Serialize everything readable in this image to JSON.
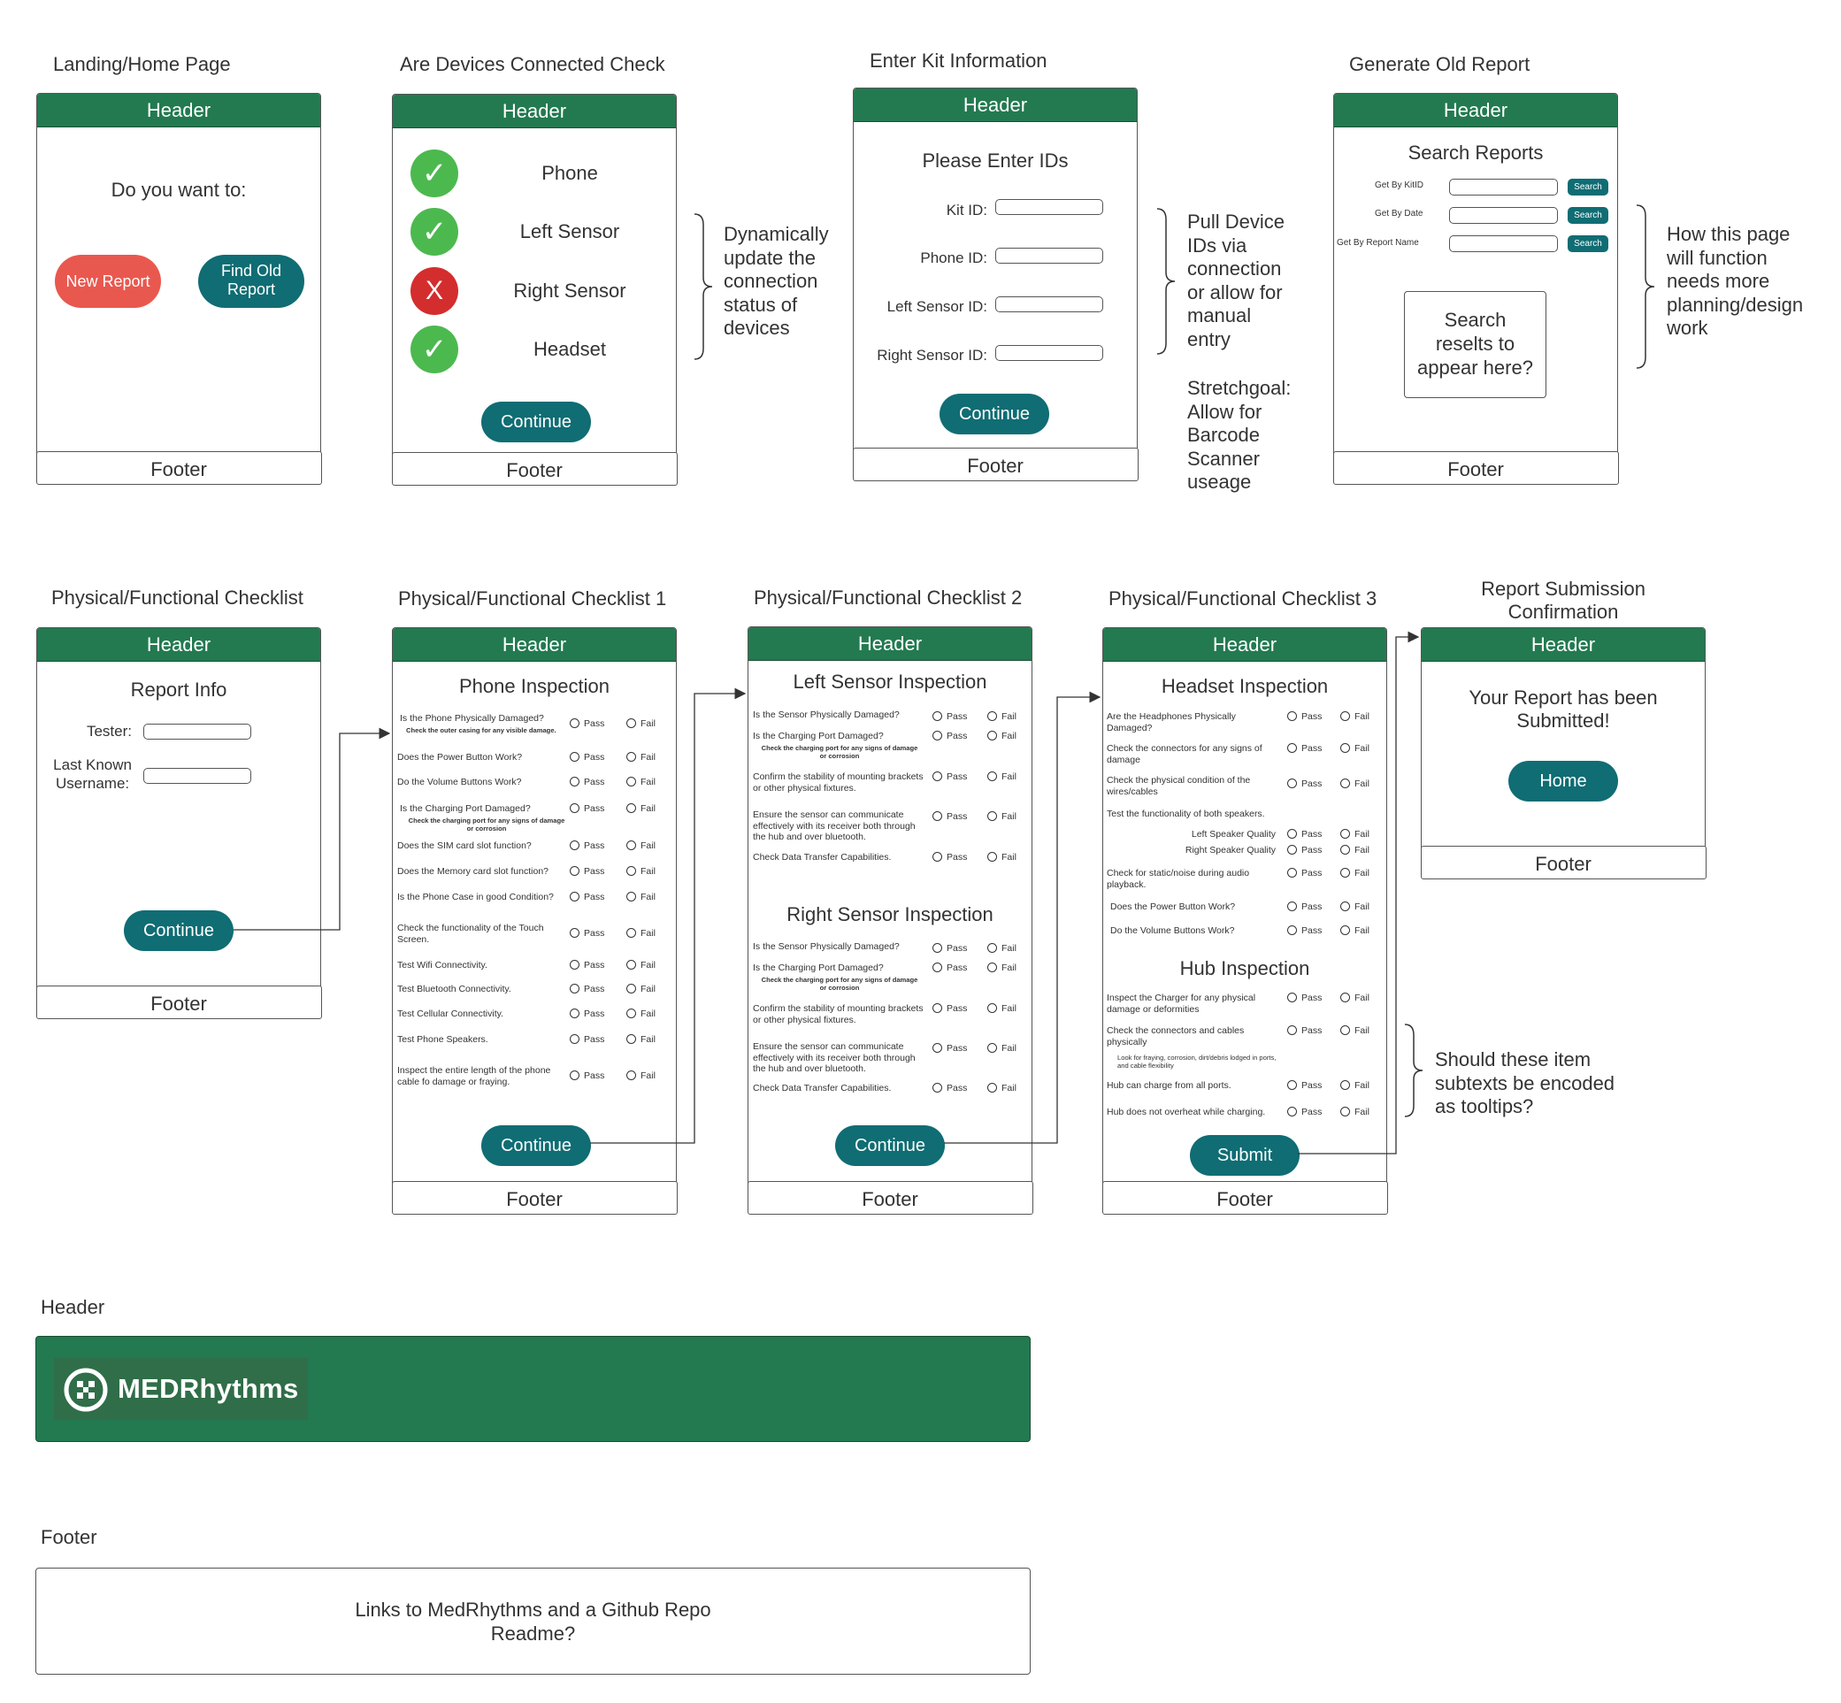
{
  "titles": {
    "landing": "Landing/Home Page",
    "devices": "Are Devices Connected Check",
    "kit": "Enter Kit Information",
    "old_report": "Generate Old Report",
    "checklist": "Physical/Functional Checklist",
    "checklist1": "Physical/Functional Checklist 1",
    "checklist2": "Physical/Functional Checklist 2",
    "checklist3": "Physical/Functional Checklist 3",
    "confirm": "Report Submission\nConfirmation",
    "header_section": "Header",
    "footer_section": "Footer"
  },
  "common": {
    "header": "Header",
    "footer": "Footer"
  },
  "landing": {
    "question": "Do you want to:",
    "new_report": "New Report",
    "find_old": "Find Old\nReport"
  },
  "devices": {
    "items": [
      {
        "label": "Phone",
        "status": "connected"
      },
      {
        "label": "Left Sensor",
        "status": "connected"
      },
      {
        "label": "Right Sensor",
        "status": "disconnected"
      },
      {
        "label": "Headset",
        "status": "connected"
      }
    ],
    "check_glyph": "✓",
    "x_glyph": "X",
    "continue": "Continue",
    "note": "Dynamically\nupdate the\nconnection\nstatus of\ndevices"
  },
  "kit": {
    "heading": "Please Enter IDs",
    "fields": [
      "Kit ID:",
      "Phone ID:",
      "Left Sensor ID:",
      "Right Sensor ID:"
    ],
    "continue": "Continue",
    "note": "Pull Device\nIDs via\nconnection\nor allow for\nmanual\nentry",
    "note2": "Stretchgoal:\nAllow for\nBarcode\nScanner\nuseage"
  },
  "old_report": {
    "heading": "Search Reports",
    "fields": [
      "Get By KitID",
      "Get By Date",
      "Get By Report Name"
    ],
    "search": "Search",
    "results": "Search\nreselts to\nappear here?",
    "note": "How this page\nwill function\nneeds more\nplanning/design\nwork"
  },
  "checklist": {
    "heading": "Report Info",
    "fields": [
      "Tester:",
      "Last Known\nUsername:"
    ],
    "continue": "Continue"
  },
  "pass": "Pass",
  "fail": "Fail",
  "checklist1": {
    "heading": "Phone Inspection",
    "rows": [
      {
        "q": "Is the Phone Physically Damaged?",
        "sub": "Check the outer casing for any visible damage."
      },
      {
        "q": "Does the Power Button Work?"
      },
      {
        "q": "Do the Volume Buttons Work?"
      },
      {
        "q": "Is the Charging Port Damaged?",
        "sub": "Check the charging port for any signs of damage or corrosion"
      },
      {
        "q": "Does the SIM card slot function?"
      },
      {
        "q": "Does the Memory card slot function?"
      },
      {
        "q": "Is the Phone Case in good Condition?"
      },
      {
        "q": "Check the functionality of the Touch Screen."
      },
      {
        "q": "Test Wifi Connectivity."
      },
      {
        "q": "Test Bluetooth Connectivity."
      },
      {
        "q": "Test Cellular Connectivity."
      },
      {
        "q": "Test Phone Speakers."
      },
      {
        "q": "Inspect the entire length of the phone cable fo damage or fraying."
      }
    ],
    "continue": "Continue"
  },
  "checklist2": {
    "heading_left": "Left Sensor Inspection",
    "heading_right": "Right Sensor Inspection",
    "rows": [
      {
        "q": "Is the Sensor Physically Damaged?"
      },
      {
        "q": "Is the Charging Port Damaged?",
        "sub": "Check the charging port for any signs of damage or corrosion"
      },
      {
        "q": "Confirm the stability of mounting brackets or other physical fixtures."
      },
      {
        "q": "Ensure the sensor can communicate effectively with its receiver both through the hub and over bluetooth."
      },
      {
        "q": "Check Data Transfer Capabilities."
      }
    ],
    "continue": "Continue"
  },
  "checklist3": {
    "heading": "Headset Inspection",
    "rows": [
      {
        "q": "Are the Headphones Physically Damaged?"
      },
      {
        "q": "Check the connectors for any signs of damage"
      },
      {
        "q": "Check the physical condition of the wires/cables"
      },
      {
        "q": "Test the functionality of both speakers."
      },
      {
        "q": "Left Speaker Quality"
      },
      {
        "q": "Right Speaker Quality"
      },
      {
        "q": "Check for static/noise during audio playback."
      },
      {
        "q": "Does the Power Button Work?"
      },
      {
        "q": "Do the Volume Buttons Work?"
      }
    ],
    "hub_heading": "Hub Inspection",
    "hub_rows": [
      {
        "q": "Inspect the Charger for any physical damage or deformities"
      },
      {
        "q": "Check the connectors and cables physically",
        "sub": "Look for fraying, corrosion, dirt/debris lodged in ports, and cable flexibility"
      },
      {
        "q": "Hub can charge from all ports."
      },
      {
        "q": "Hub does not overheat while charging."
      }
    ],
    "submit": "Submit",
    "note": "Should these item\nsubtexts be encoded\nas tooltips?"
  },
  "confirm": {
    "message": "Your Report has been\nSubmitted!",
    "home": "Home"
  },
  "header_banner": {
    "logo_text": "MEDRhythms",
    "color": "#237a50"
  },
  "footer_banner": {
    "text": "Links to MedRhythms and a Github Repo\nReadme?"
  },
  "colors": {
    "header_green": "#237a50",
    "teal": "#0f6d73",
    "red_button": "#e9584f",
    "check_green": "#4cb94f",
    "x_red": "#d42d2d"
  }
}
